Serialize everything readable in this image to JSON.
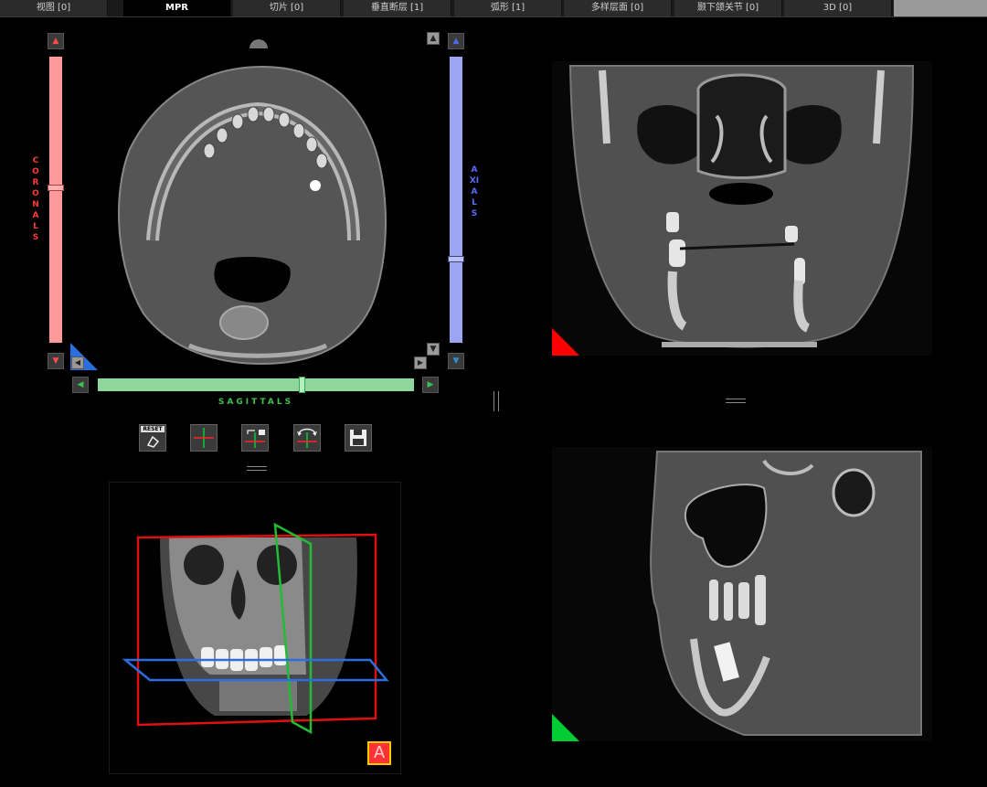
{
  "tabs": [
    {
      "label": "视图 [0]",
      "active": false
    },
    {
      "label": "MPR",
      "active": true
    },
    {
      "label": "切片 [0]",
      "active": false
    },
    {
      "label": "垂直断层 [1]",
      "active": false
    },
    {
      "label": "弧形 [1]",
      "active": false
    },
    {
      "label": "多样层面 [0]",
      "active": false
    },
    {
      "label": "颞下颌关节 [0]",
      "active": false
    },
    {
      "label": "3D [0]",
      "active": false
    }
  ],
  "axial_view": {
    "coronal_label": "CORONALS",
    "axial_label": "AXIALS",
    "sagittal_label": "SAGITTALS",
    "coronal_color": "#ff8a8a",
    "axial_color": "#9aa6f2",
    "sagittal_color": "#8fd69a"
  },
  "toolbar": {
    "reset_label": "RESET"
  },
  "view3d": {
    "orientation_label": "A"
  },
  "colors": {
    "coronal_marker": "#ff0000",
    "sagittal_marker": "#00cc33",
    "axial_marker": "#2a6fe0"
  }
}
